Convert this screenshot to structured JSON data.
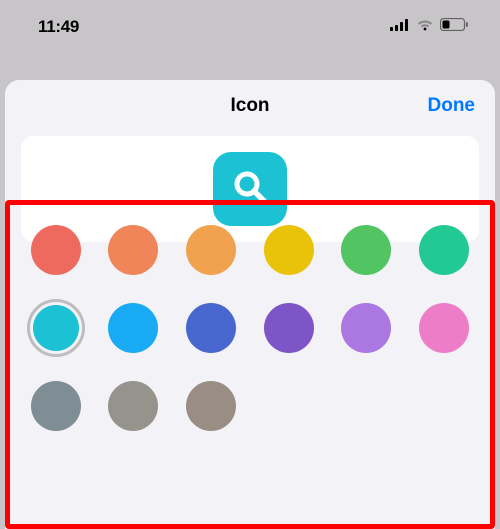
{
  "status_bar": {
    "time": "11:49"
  },
  "sheet": {
    "title": "Icon",
    "done_label": "Done",
    "preview_icon_name": "search-icon",
    "preview_color": "#1cc2d4"
  },
  "palette": {
    "colors": [
      {
        "name": "red",
        "hex": "#ee6a5e",
        "selected": false
      },
      {
        "name": "orange",
        "hex": "#ef8558",
        "selected": false
      },
      {
        "name": "light-orange",
        "hex": "#f0a24f",
        "selected": false
      },
      {
        "name": "yellow",
        "hex": "#e9c20a",
        "selected": false
      },
      {
        "name": "green",
        "hex": "#52c562",
        "selected": false
      },
      {
        "name": "mint",
        "hex": "#22c993",
        "selected": false
      },
      {
        "name": "teal",
        "hex": "#1cc2d4",
        "selected": true
      },
      {
        "name": "sky-blue",
        "hex": "#18aaf3",
        "selected": false
      },
      {
        "name": "indigo",
        "hex": "#4767cf",
        "selected": false
      },
      {
        "name": "purple",
        "hex": "#7c55c6",
        "selected": false
      },
      {
        "name": "lavender",
        "hex": "#ab77e1",
        "selected": false
      },
      {
        "name": "pink",
        "hex": "#ee7dc8",
        "selected": false
      },
      {
        "name": "slate",
        "hex": "#7f8d95",
        "selected": false
      },
      {
        "name": "grey",
        "hex": "#96938d",
        "selected": false
      },
      {
        "name": "taupe",
        "hex": "#9a8e84",
        "selected": false
      }
    ]
  }
}
